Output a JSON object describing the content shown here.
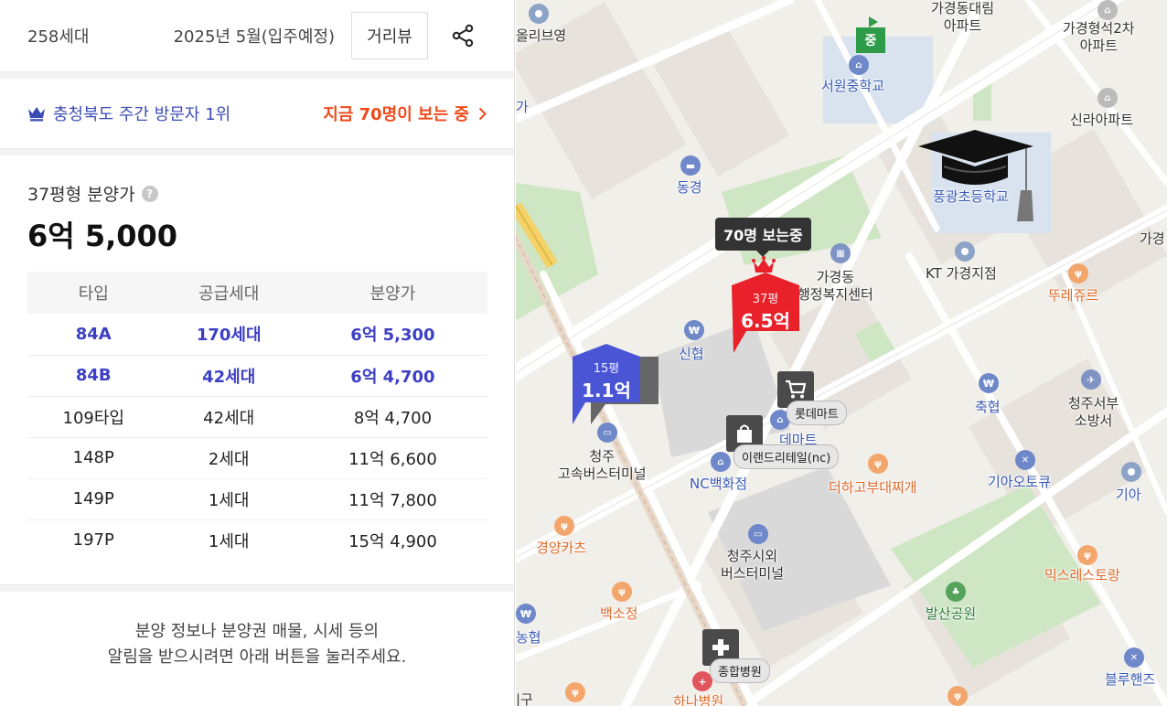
{
  "header": {
    "units": "258세대",
    "move_in": "2025년 5월(입주예정)",
    "street_view_label": "거리뷰"
  },
  "rank": {
    "text": "충청북도 주간 방문자 1위",
    "viewing": "지금 70명이 보는 중"
  },
  "price": {
    "label": "37평형 분양가",
    "value": "6억 5,000"
  },
  "table": {
    "headers": [
      "타입",
      "공급세대",
      "분양가"
    ],
    "rows": [
      {
        "type": "84A",
        "supply": "170세대",
        "price": "6억 5,300",
        "highlight": true
      },
      {
        "type": "84B",
        "supply": "42세대",
        "price": "6억 4,700",
        "highlight": true
      },
      {
        "type": "109타입",
        "supply": "42세대",
        "price": "8억 4,700",
        "highlight": false
      },
      {
        "type": "148P",
        "supply": "2세대",
        "price": "11억 6,600",
        "highlight": false
      },
      {
        "type": "149P",
        "supply": "1세대",
        "price": "11억 7,800",
        "highlight": false
      },
      {
        "type": "197P",
        "supply": "1세대",
        "price": "15억 4,900",
        "highlight": false
      }
    ]
  },
  "notice": {
    "line1": "분양 정보나 분양권 매물, 시세 등의",
    "line2": "알림을 받으시려면 아래 버튼을 눌러주세요."
  },
  "map": {
    "labels": {
      "gagyeong_daelim": "가경동대림\n아파트",
      "gagyeong_hyeongseok": "가경형석2차\n아파트",
      "seowon_middle": "서원중학교",
      "shinra": "신라아파트",
      "pungkwang": "풍광초등학교",
      "ollive": "올리브영",
      "ga": "가",
      "donggyeong": "동경",
      "gagyeong_office": "가경동\n행정복지센터",
      "kt": "KT 가경지점",
      "ttureju": "뚜레쥬르",
      "gagyeong_right": "가경",
      "shinhyup": "신협",
      "lotte_mart": "롯데마트",
      "emart_partial": "데마트",
      "eland": "이랜드리테일(nc)",
      "nc": "NC백화점",
      "cheongju_terminal": "청주\n고속버스터미널",
      "chukhyup": "축협",
      "fire": "청주서부\n소방서",
      "stew": "더하고부대찌개",
      "kia": "기아오토큐",
      "kia_right": "기아",
      "gyeongyang": "경양카츠",
      "cheongju_intercity": "청주시외\n버스터미널",
      "mix": "믹스레스토랑",
      "baekso": "백소정",
      "balsan": "발산공원",
      "nonghyup": "농협",
      "hospital": "종합병원",
      "hanna": "하나병원",
      "blue": "블루핸즈",
      "bottom_gu": "|구",
      "school_flag": "중"
    },
    "tooltip": "70명 보는중",
    "marker_main": {
      "size": "37평",
      "price": "6.5억"
    },
    "marker_other": {
      "size": "15평",
      "price": "1.1억"
    }
  },
  "colors": {
    "accent_blue": "#3d3fc4",
    "accent_orange": "#f04a1a",
    "marker_red": "#e8212b",
    "marker_blue": "#4a55d6"
  }
}
